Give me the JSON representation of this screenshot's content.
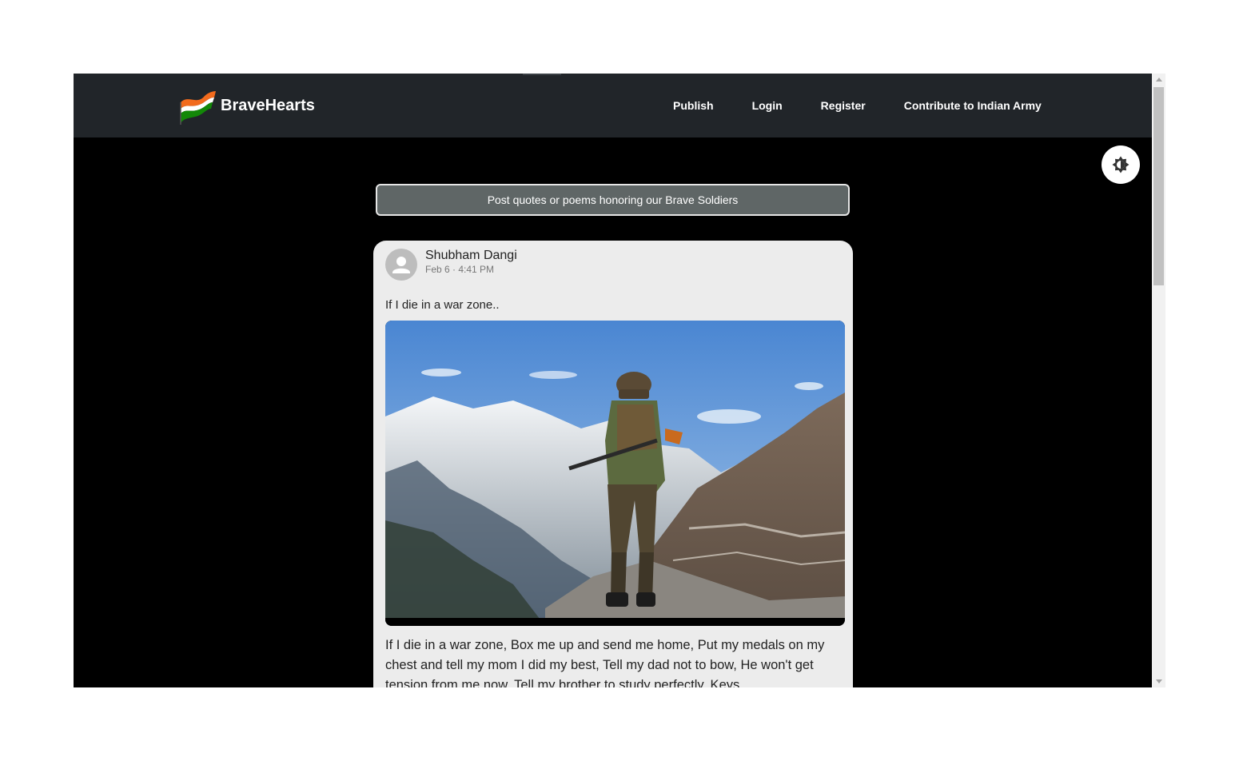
{
  "navbar": {
    "brand": "BraveHearts",
    "links": [
      "Publish",
      "Login",
      "Register",
      "Contribute to Indian Army"
    ]
  },
  "theme_toggle_icon": "brightness-icon",
  "prompt_button": "Post quotes or poems honoring our Brave Soldiers",
  "post": {
    "author": "Shubham Dangi",
    "time": "Feb 6 · 4:41 PM",
    "title": "If I die in a war zone..",
    "image_icon": "soldier-mountain-photo",
    "body": "If I die in a war zone, Box me up and send me home, Put my medals on my chest and tell my mom I did my best, Tell my dad not to bow, He won't get tension from me now, Tell my brother to study perfectly, Keys"
  },
  "colors": {
    "navbar": "#212529",
    "background": "#000000",
    "card": "#ececec",
    "saffron": "#f26b1d",
    "green": "#138808"
  }
}
